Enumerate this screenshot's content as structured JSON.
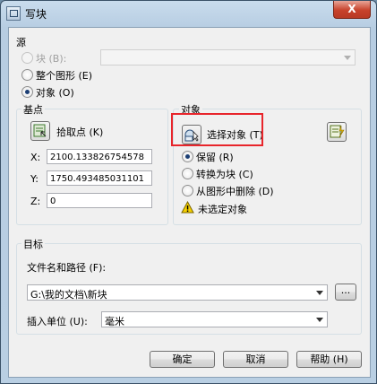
{
  "window": {
    "title": "写块",
    "close_glyph": "X"
  },
  "source": {
    "heading": "源",
    "block_label": "块 (B):",
    "block_value": "",
    "entire_drawing_label": "整个图形 (E)",
    "objects_label": "对象 (O)",
    "selected": "objects"
  },
  "base_point": {
    "heading": "基点",
    "pick_label": "拾取点 (K)",
    "x_label": "X:",
    "x_value": "2100.133826754578",
    "y_label": "Y:",
    "y_value": "1750.493485031101",
    "z_label": "Z:",
    "z_value": "0"
  },
  "objects": {
    "heading": "对象",
    "select_label": "选择对象 (T)",
    "retain_label": "保留 (R)",
    "convert_label": "转换为块 (C)",
    "delete_label": "从图形中删除 (D)",
    "selected": "retain",
    "warning_text": "未选定对象"
  },
  "target": {
    "heading": "目标",
    "filename_label": "文件名和路径 (F):",
    "filename_value": "G:\\我的文档\\新块",
    "browse_label": "...",
    "units_label": "插入单位 (U):",
    "units_value": "毫米"
  },
  "buttons": {
    "ok": "确定",
    "cancel": "取消",
    "help": "帮助 (H)"
  },
  "colors": {
    "highlight": "#e8252b",
    "radio_dot": "#1b3e74"
  }
}
